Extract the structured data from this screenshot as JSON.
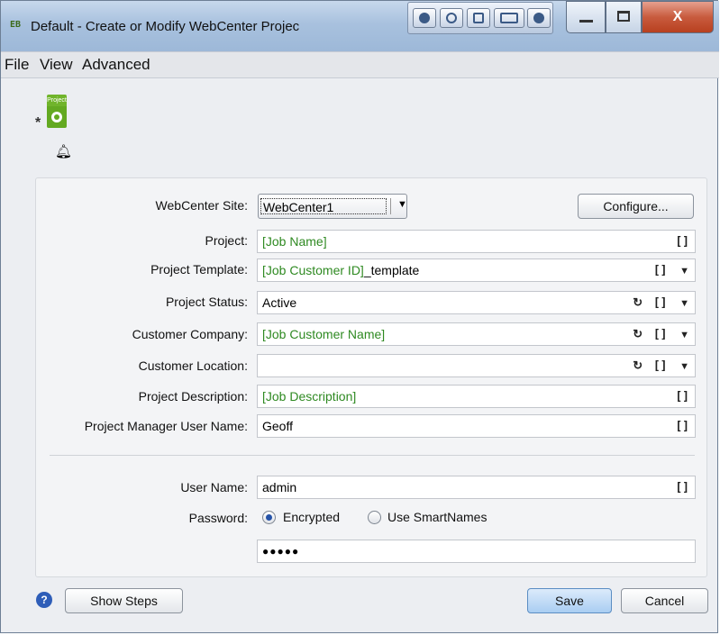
{
  "window": {
    "app_icon": "EB",
    "title": "Default - Create or Modify WebCenter Projec",
    "close_label": "X"
  },
  "menu": {
    "items": [
      "File",
      "View",
      "Advanced"
    ]
  },
  "project_icon": {
    "badge_text": "Project",
    "asterisk": "*"
  },
  "form": {
    "webcenter_site": {
      "label": "WebCenter Site:",
      "value": "WebCenter1",
      "configure_label": "Configure..."
    },
    "project": {
      "label": "Project:",
      "value": "[Job Name]"
    },
    "project_template": {
      "label": "Project Template:",
      "smartname": "[Job Customer ID]",
      "suffix": "_template"
    },
    "project_status": {
      "label": "Project Status:",
      "value": "Active"
    },
    "customer_company": {
      "label": "Customer Company:",
      "value": "[Job Customer Name]"
    },
    "customer_location": {
      "label": "Customer Location:",
      "value": ""
    },
    "project_description": {
      "label": "Project Description:",
      "value": "[Job Description]"
    },
    "project_manager": {
      "label": "Project Manager User Name:",
      "value": "Geoff"
    },
    "user_name": {
      "label": "User Name:",
      "value": "admin"
    },
    "password": {
      "label": "Password:",
      "option_encrypted": "Encrypted",
      "option_smartnames": "Use SmartNames",
      "selected": "Encrypted",
      "masked_value": "●●●●●"
    },
    "icons": {
      "brackets": "[]",
      "refresh": "ꝏ",
      "dropdown": "▼"
    }
  },
  "footer": {
    "help_icon": "?",
    "show_steps_label": "Show Steps",
    "save_label": "Save",
    "cancel_label": "Cancel"
  },
  "colors": {
    "smartname_green": "#2f8a22",
    "title_bar": "#a8c1de",
    "close_button": "#c85b3e"
  }
}
